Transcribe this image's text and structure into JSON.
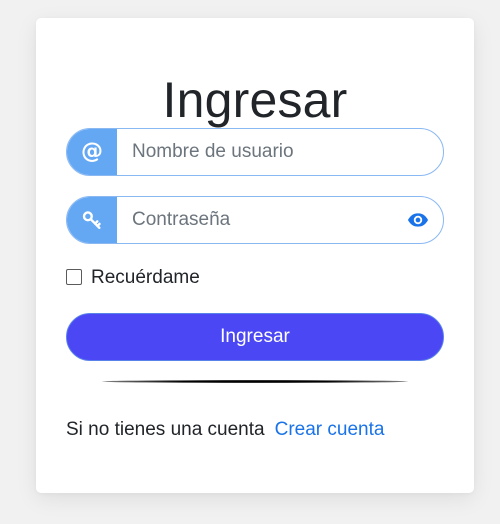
{
  "login": {
    "title": "Ingresar",
    "username_placeholder": "Nombre de usuario",
    "username_value": "",
    "username_icon": "at-icon",
    "username_icon_glyph": "@",
    "password_placeholder": "Contraseña",
    "password_value": "",
    "password_icon": "key-icon",
    "show_password_icon": "eye-icon",
    "remember_label": "Recuérdame",
    "remember_checked": false,
    "submit_label": "Ingresar",
    "signup_prompt": "Si no tienes una cuenta",
    "signup_link": "Crear cuenta"
  },
  "colors": {
    "addon_bg": "#64a8f4",
    "submit_bg": "#4b47f5",
    "link": "#1a73e8",
    "field_border": "#8ab8f3"
  }
}
